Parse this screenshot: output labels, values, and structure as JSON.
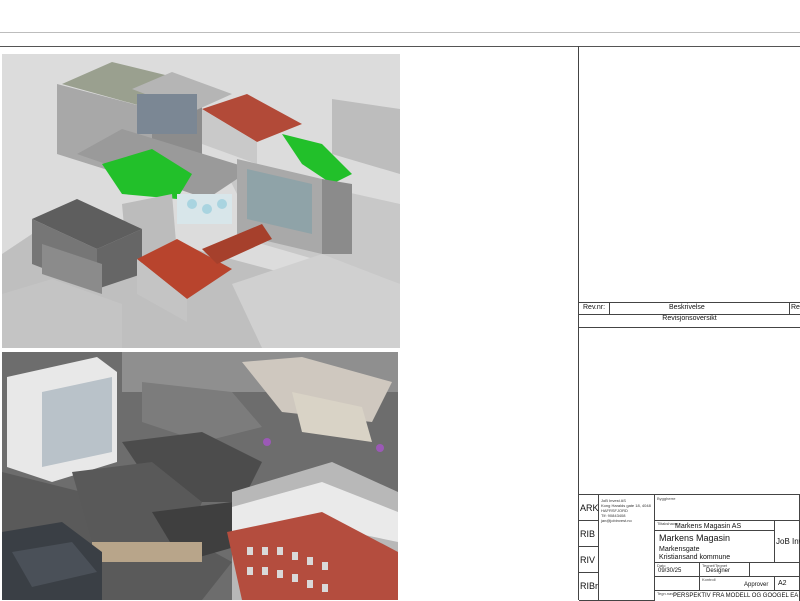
{
  "revisions": {
    "col_rev": "Rev.nr:",
    "col_desc": "Beskrivelse",
    "col_extra": "Re",
    "title": "Revisjonsoversikt"
  },
  "disciplines": [
    "ARK",
    "RIB",
    "RIV",
    "RIBr"
  ],
  "company": {
    "name": "JoB Invest AS",
    "address": "Kong Haralds gate 18, 4048 HAFRSFJORD",
    "phone": "Tlf: 90843408",
    "email": "jan@jobinvest.no",
    "short": "JoB Inv"
  },
  "title_block": {
    "label_byggherre": "Byggherre",
    "label_tiltakshaver": "Tiltakshaver",
    "owner": "Markens Magasin AS",
    "project": "Markens Magasin",
    "address_line1": "Markensgate",
    "address_line2": "Kristiansand kommune",
    "label_dato": "Dato",
    "date": "09/30/25",
    "label_tegnet": "Tegnet/Tegnet",
    "designer": "Designer",
    "label_kontroll": "Kontroll",
    "approver": "Approver",
    "label_format": "Målestokk",
    "format": "A2",
    "label_tegn": "Tegn.navn",
    "drawing_title": "PERSPEKTIV FRA MODELL OG GOOGEL EA"
  }
}
